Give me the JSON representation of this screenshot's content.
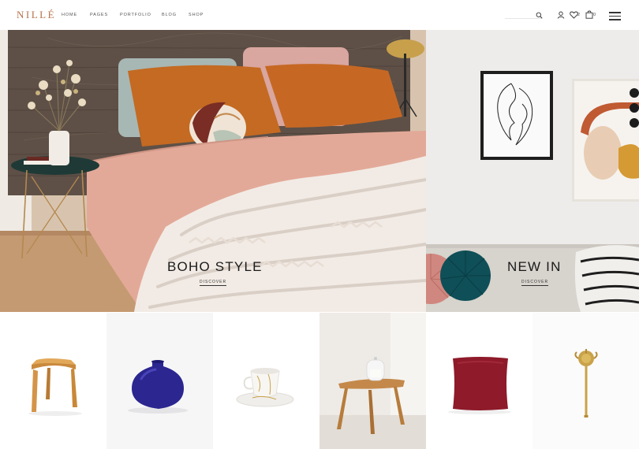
{
  "header": {
    "logo": "NILLÉ",
    "nav": [
      "HOME",
      "PAGES",
      "PORTFOLIO",
      "BLOG",
      "SHOP"
    ],
    "search_placeholder": "",
    "wishlist_count": "2",
    "cart_count": "0",
    "icons": [
      "search-icon",
      "user-icon",
      "heart-icon",
      "shopping-bag-icon",
      "hamburger-menu-icon"
    ]
  },
  "banners": [
    {
      "title": "BOHO STYLE",
      "link": "DISCOVER"
    },
    {
      "title": "NEW IN",
      "link": "DISCOVER"
    }
  ],
  "products": [
    {
      "name": "wooden-stool"
    },
    {
      "name": "blue-vase"
    },
    {
      "name": "marble-cup"
    },
    {
      "name": "side-table"
    },
    {
      "name": "red-pillow"
    },
    {
      "name": "brass-hook"
    }
  ],
  "colors": {
    "accent": "#b8704a",
    "text": "#1a1a1a"
  }
}
